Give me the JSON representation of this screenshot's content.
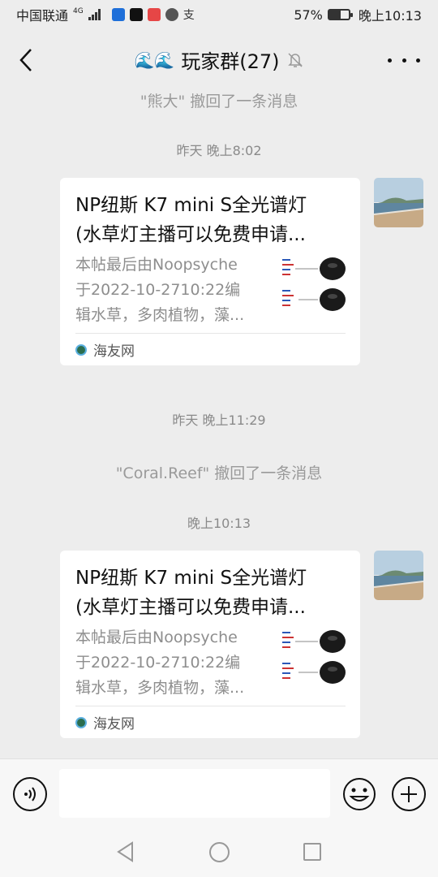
{
  "status_bar": {
    "carrier": "中国联通",
    "network": "4G",
    "battery_percent": "57%",
    "battery_level": 0.57,
    "time": "晚上10:13"
  },
  "header": {
    "back_icon": "chevron-left-icon",
    "title": "玩家群(27)",
    "title_prefix_icons": "wave-icon",
    "mute_icon": "bell-off-icon",
    "more_icon": "more-dots-icon"
  },
  "messages": {
    "recall_1": "\"熊大\" 撤回了一条消息",
    "time_1": "昨天 晚上8:02",
    "card_1": {
      "title_line1": "NP纽斯 K7 mini S全光谱灯",
      "title_line2": "(水草灯主播可以免费申请...",
      "desc_line1": "本帖最后由Noopsyche",
      "desc_line2": "于2022-10-2710:22编",
      "desc_line3": "辑水草，多肉植物，藻...",
      "source": "海友网"
    },
    "time_2": "昨天 晚上11:29",
    "recall_2": "\"Coral.Reef\" 撤回了一条消息",
    "time_3": "晚上10:13",
    "card_2": {
      "title_line1": "NP纽斯 K7 mini S全光谱灯",
      "title_line2": "(水草灯主播可以免费申请...",
      "desc_line1": "本帖最后由Noopsyche",
      "desc_line2": "于2022-10-2710:22编",
      "desc_line3": "辑水草，多肉植物，藻...",
      "source": "海友网"
    }
  },
  "input_bar": {
    "voice_icon": "voice-icon",
    "emoji_icon": "emoji-icon",
    "plus_icon": "plus-icon",
    "text_value": ""
  },
  "colors": {
    "background": "#ededed",
    "card": "#ffffff",
    "system_text": "#9a9a9a"
  }
}
